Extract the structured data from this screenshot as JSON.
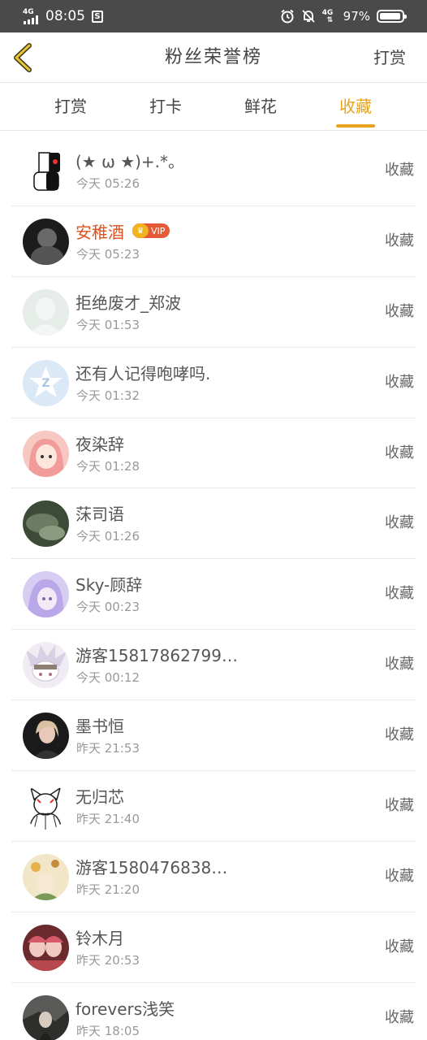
{
  "status_bar": {
    "network": "4G",
    "time": "08:05",
    "notification_icon": "S",
    "network_right": "4G",
    "battery_percent": "97%",
    "battery_level": 0.97
  },
  "header": {
    "title": "粉丝荣誉榜",
    "right_action": "打赏"
  },
  "tabs": [
    {
      "label": "打赏",
      "active": false
    },
    {
      "label": "打卡",
      "active": false
    },
    {
      "label": "鲜花",
      "active": false
    },
    {
      "label": "收藏",
      "active": true
    }
  ],
  "colors": {
    "accent": "#e8a21b",
    "vip_name": "#d9531e",
    "status_bar": "#4a4a4a"
  },
  "list": [
    {
      "name": "(★ ω ★)+.*。",
      "time": "今天 05:26",
      "action": "收藏"
    },
    {
      "name": "安稚酒",
      "vip": "VIP",
      "time": "今天 05:23",
      "action": "收藏"
    },
    {
      "name": "拒绝废才_郑波",
      "time": "今天 01:53",
      "action": "收藏"
    },
    {
      "name": "还有人记得咆哮吗.",
      "time": "今天 01:32",
      "action": "收藏"
    },
    {
      "name": "夜染辞",
      "time": "今天 01:28",
      "action": "收藏"
    },
    {
      "name": "莯司语",
      "time": "今天 01:26",
      "action": "收藏"
    },
    {
      "name": "Sky-顾辞",
      "time": "今天 00:23",
      "action": "收藏"
    },
    {
      "name": "游客15817862799…",
      "time": "今天 00:12",
      "action": "收藏"
    },
    {
      "name": "墨书恒",
      "time": "昨天 21:53",
      "action": "收藏"
    },
    {
      "name": "无归芯",
      "time": "昨天 21:40",
      "action": "收藏"
    },
    {
      "name": "游客1580476838…",
      "time": "昨天 21:20",
      "action": "收藏"
    },
    {
      "name": "铃木月",
      "time": "昨天 20:53",
      "action": "收藏"
    },
    {
      "name": "forevers浅笑",
      "time": "昨天 18:05",
      "action": "收藏"
    }
  ]
}
